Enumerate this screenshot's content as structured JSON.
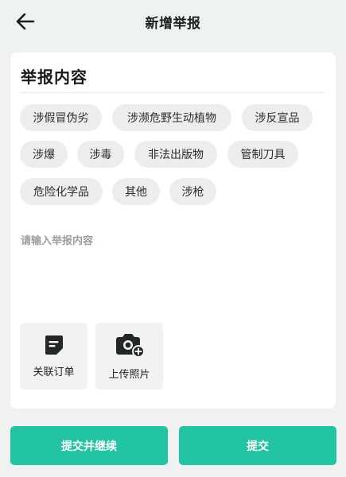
{
  "header": {
    "title": "新增举报",
    "back_icon": "arrow-left-icon"
  },
  "report": {
    "section_title": "举报内容",
    "categories": [
      {
        "label": "涉假冒伪劣"
      },
      {
        "label": "涉濒危野生动植物"
      },
      {
        "label": "涉反宣品"
      },
      {
        "label": "涉爆"
      },
      {
        "label": "涉毒"
      },
      {
        "label": "非法出版物"
      },
      {
        "label": "管制刀具"
      },
      {
        "label": "危险化学品"
      },
      {
        "label": "其他"
      },
      {
        "label": "涉枪"
      }
    ],
    "content_input": {
      "value": "",
      "placeholder": "请输入举报内容"
    },
    "attachments": [
      {
        "label": "关联订单",
        "icon": "document-icon"
      },
      {
        "label": "上传照片",
        "icon": "camera-plus-icon"
      }
    ]
  },
  "actions": {
    "submit_continue_label": "提交并继续",
    "submit_label": "提交"
  },
  "colors": {
    "accent": "#22c4a3",
    "chip_bg": "#eceeed",
    "page_bg": "#eff2f0"
  }
}
